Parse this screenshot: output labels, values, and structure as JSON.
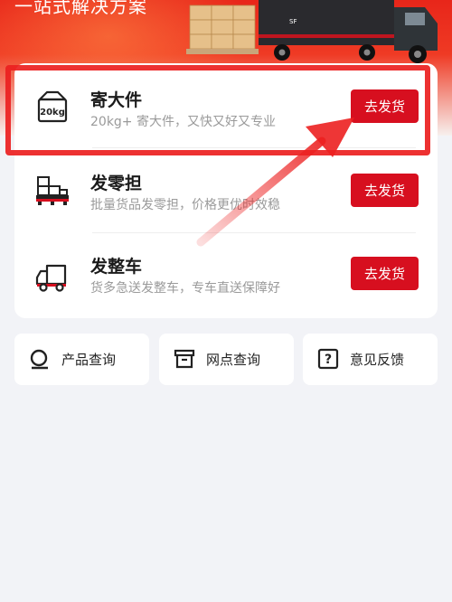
{
  "banner": {
    "title": "一站式解决方案"
  },
  "services": [
    {
      "title": "寄大件",
      "description": "20kg+ 寄大件，又快又好又专业",
      "icon": "package-20kg-icon",
      "icon_text": "20kg",
      "button": "去发货"
    },
    {
      "title": "发零担",
      "description": "批量货品发零担，价格更优时效稳",
      "icon": "pallet-stack-icon",
      "button": "去发货"
    },
    {
      "title": "发整车",
      "description": "货多急送发整车，专车直送保障好",
      "icon": "truck-icon",
      "button": "去发货"
    }
  ],
  "tools": [
    {
      "label": "产品查询",
      "icon": "search-icon"
    },
    {
      "label": "网点查询",
      "icon": "store-icon"
    },
    {
      "label": "意见反馈",
      "icon": "feedback-question-icon"
    }
  ],
  "colors": {
    "brand_red": "#d70f1f",
    "page_bg": "#f2f3f7",
    "annotation_red": "#ec2020"
  }
}
